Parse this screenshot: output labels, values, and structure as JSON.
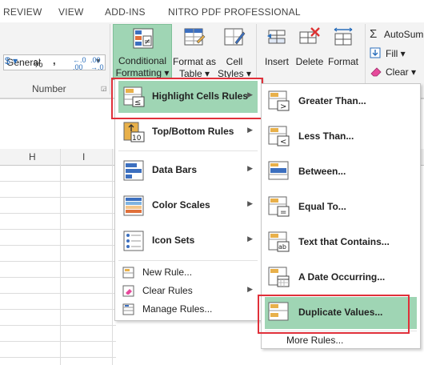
{
  "tabs": [
    "REVIEW",
    "VIEW",
    "ADD-INS",
    "NITRO PDF PROFESSIONAL"
  ],
  "number_group": {
    "format_value": "General",
    "currency_symbol": "$",
    "percent_symbol": "%",
    "comma_symbol": ",",
    "increase_decimal": "←.0\n.00",
    "decrease_decimal": ".00\n→.0",
    "label": "Number"
  },
  "ribbon_buttons": {
    "conditional_formatting": [
      "Conditional",
      "Formatting ▾"
    ],
    "format_as_table": [
      "Format as",
      "Table ▾"
    ],
    "cell_styles": [
      "Cell",
      "Styles ▾"
    ],
    "insert": "Insert",
    "delete": "Delete",
    "format": "Format",
    "autosum": "AutoSum",
    "fill": "Fill ▾",
    "clear": "Clear ▾"
  },
  "columns": [
    "H",
    "I"
  ],
  "cf_menu": {
    "items": [
      {
        "label": "Highlight Cells Rules",
        "hotkey_index": 0
      },
      {
        "label": "Top/Bottom Rules",
        "hotkey_index": 0
      },
      {
        "label": "Data Bars",
        "hotkey_index": 0
      },
      {
        "label": "Color Scales",
        "hotkey_index": 6
      },
      {
        "label": "Icon Sets",
        "hotkey_index": 0
      }
    ],
    "small_items": [
      "New Rule...",
      "Clear Rules",
      "Manage Rules..."
    ]
  },
  "highlight_menu": {
    "items": [
      "Greater Than...",
      "Less Than...",
      "Between...",
      "Equal To...",
      "Text that Contains...",
      "A Date Occurring...",
      "Duplicate Values..."
    ],
    "more_rules": "More Rules..."
  },
  "colors": {
    "highlight": "#9fd5b4",
    "callout": "#e0303a"
  }
}
